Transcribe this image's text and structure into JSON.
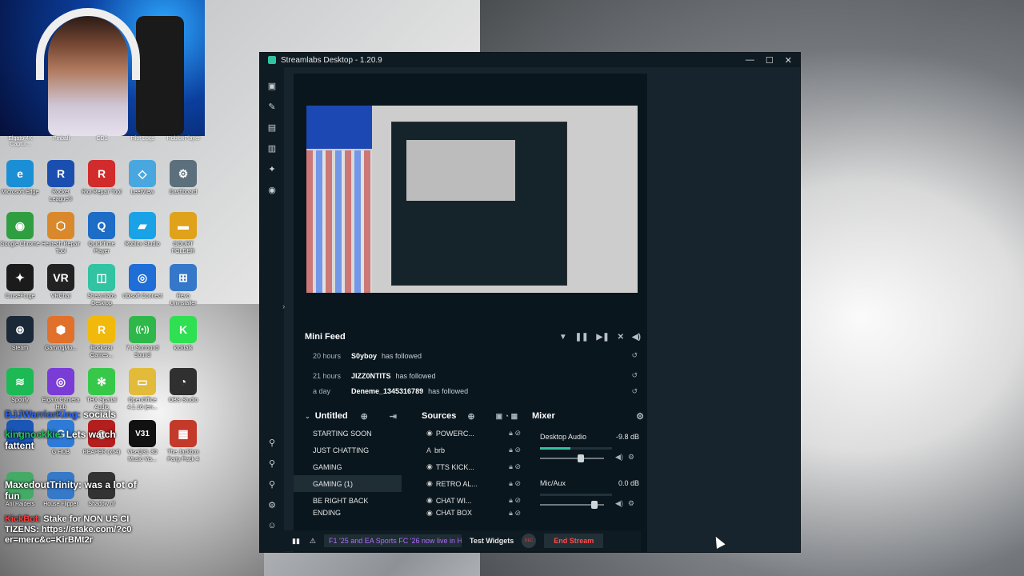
{
  "webcam_labels": [
    "Elgato 4K Captur...",
    "Pinball",
    "CD1",
    "Riot Logs",
    "RobloxPlayer"
  ],
  "desktop_icons": [
    {
      "label": "Microsoft Edge",
      "color": "#1b8fd6",
      "glyph": "e"
    },
    {
      "label": "Rocket League®",
      "color": "#1a4fb0",
      "glyph": "R"
    },
    {
      "label": "Riot Repair Tool",
      "color": "#d12b2b",
      "glyph": "R"
    },
    {
      "label": "LeetView",
      "color": "#49a7e0",
      "glyph": "◇"
    },
    {
      "label": "Dashboard",
      "color": "#5c6f7c",
      "glyph": "⚙"
    },
    {
      "label": "Google Chrome",
      "color": "#2f9e41",
      "glyph": "◉"
    },
    {
      "label": "Hextech Repair Tool",
      "color": "#d9892b",
      "glyph": "⬡"
    },
    {
      "label": "QuickTime Player",
      "color": "#1d6cc6",
      "glyph": "Q"
    },
    {
      "label": "Roblox Studio",
      "color": "#1aa2e6",
      "glyph": "▰"
    },
    {
      "label": "GOURT FOLDER",
      "color": "#e0a21a",
      "glyph": "▬"
    },
    {
      "label": "CurseForge",
      "color": "#1b1b1b",
      "glyph": "✦"
    },
    {
      "label": "VRChat",
      "color": "#222",
      "glyph": "VR"
    },
    {
      "label": "Streamlabs Desktop",
      "color": "#31c3a2",
      "glyph": "◫"
    },
    {
      "label": "Ubisoft Connect",
      "color": "#1f6dd6",
      "glyph": "◎"
    },
    {
      "label": "Revo Uninstaller",
      "color": "#3577c8",
      "glyph": "⊞"
    },
    {
      "label": "Steam",
      "color": "#1b2838",
      "glyph": "⊛"
    },
    {
      "label": "GamingMo...",
      "color": "#e0702a",
      "glyph": "⬢"
    },
    {
      "label": "Rockstar Games...",
      "color": "#f2b90d",
      "glyph": "R"
    },
    {
      "label": "7.1 Surround Sound",
      "color": "#2fb84a",
      "glyph": "((•))"
    },
    {
      "label": "kicktalk",
      "color": "#2ee052",
      "glyph": "K"
    },
    {
      "label": "Spotify",
      "color": "#1db954",
      "glyph": "≋"
    },
    {
      "label": "Elgato Camera Hub",
      "color": "#7a3cd6",
      "glyph": "◎"
    },
    {
      "label": "THX Spatial Audio",
      "color": "#37c84a",
      "glyph": "✻"
    },
    {
      "label": "OpenOffice 4.1.16 (en...",
      "color": "#e2bb3b",
      "glyph": "▭"
    },
    {
      "label": "OBS Studio",
      "color": "#303030",
      "glyph": "◔"
    },
    {
      "label": "",
      "color": "#1b55b5",
      "glyph": "◐"
    },
    {
      "label": "G HUB",
      "color": "#2d7bd6",
      "glyph": "G"
    },
    {
      "label": "REAPER (x64)",
      "color": "#b31e1e",
      "glyph": "◉"
    },
    {
      "label": "ViseQ31 3D Music Vis...",
      "color": "#111",
      "glyph": "V31"
    },
    {
      "label": "The Jackbox Party Pack 4",
      "color": "#c33a2b",
      "glyph": "▦"
    },
    {
      "label": "Ani Raiders",
      "color": "#4a6",
      "glyph": ""
    },
    {
      "label": "House Flipper",
      "color": "#3579c8",
      "glyph": ""
    },
    {
      "label": "Shadow of",
      "color": "#333",
      "glyph": ""
    }
  ],
  "chat": [
    {
      "user": "BJJWarriorKing:",
      "msg": "socials",
      "ucolor": "n1"
    },
    {
      "user": "kingnockkie:",
      "msg": "Lets watch fattent",
      "ucolor": "n2"
    },
    {
      "user": "MaxedoutTrinity:",
      "msg": "was a lot of fun",
      "ucolor": "n3"
    },
    {
      "user": "KickBot:",
      "msg": "Stake for NON US CITIZENS: https://stake.com/?c0er=merc&c=KirBMt2r",
      "ucolor": "n4"
    }
  ],
  "window": {
    "title": "Streamlabs Desktop - 1.20.9",
    "minimize": "—",
    "maximize": "☐",
    "close": "✕"
  },
  "minifeed": {
    "title": "Mini Feed",
    "rows": [
      {
        "time": "20 hours",
        "user": "S0yboy",
        "action": "has followed"
      },
      {
        "time": "21 hours",
        "user": "JIZZ0NTITS",
        "action": "has followed"
      },
      {
        "time": "a day",
        "user": "Deneme_1345316789",
        "action": "has followed"
      }
    ]
  },
  "scenes": {
    "title": "Untitled",
    "items": [
      "STARTING SOON",
      "JUST CHATTING",
      "GAMING",
      "GAMING (1)",
      "BE RIGHT BACK",
      "ENDING"
    ],
    "selected": 3
  },
  "sources": {
    "title": "Sources",
    "items": [
      {
        "icon": "◉",
        "name": "POWERC..."
      },
      {
        "icon": "A",
        "name": "brb"
      },
      {
        "icon": "◉",
        "name": "TTS KICK..."
      },
      {
        "icon": "◉",
        "name": "RETRO AL..."
      },
      {
        "icon": "◉",
        "name": "CHAT WI..."
      },
      {
        "icon": "◉",
        "name": "CHAT BOX"
      }
    ]
  },
  "mixer": {
    "title": "Mixer",
    "channels": [
      {
        "name": "Desktop Audio",
        "db": "-9.8 dB",
        "level": 0.42,
        "volume": 0.64
      },
      {
        "name": "Mic/Aux",
        "db": "0.0 dB",
        "level": 0.0,
        "volume": 0.85
      }
    ]
  },
  "footer": {
    "ticker": "F1 '25 and EA Sports FC '26 now live in Hi",
    "test_widgets": "Test Widgets",
    "rec": "REC",
    "end_stream": "End Stream"
  }
}
